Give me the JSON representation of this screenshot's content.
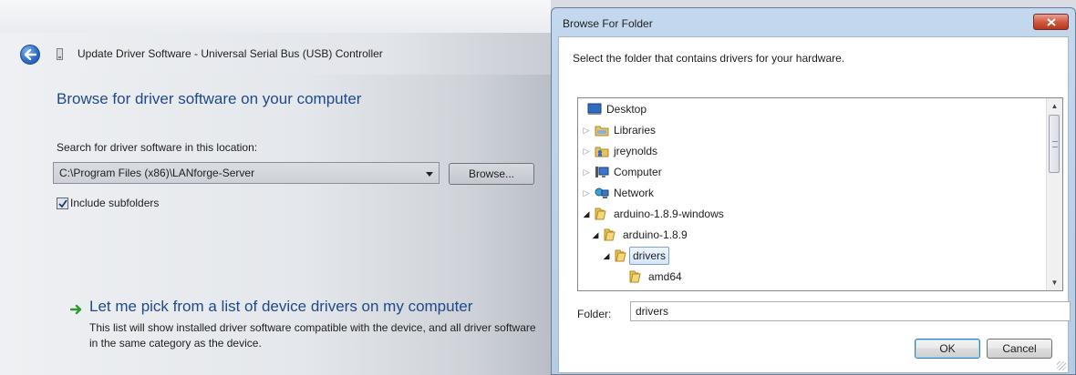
{
  "wizard": {
    "title": "Update Driver Software - Universal Serial Bus (USB) Controller",
    "heading": "Browse for driver software on your computer",
    "search_label": "Search for driver software in this location:",
    "path_value": "C:\\Program Files (x86)\\LANforge-Server",
    "browse_label": "Browse...",
    "include_subfolders_label": "Include subfolders",
    "include_subfolders_checked": true,
    "pick_title": "Let me pick from a list of device drivers on my computer",
    "pick_description": "This list will show installed driver software compatible with the device, and all driver software in the same category as the device."
  },
  "dialog": {
    "title": "Browse For Folder",
    "instruction": "Select the folder that contains drivers for your hardware.",
    "tree": [
      {
        "label": "Desktop",
        "icon": "desktop-icon",
        "expander": "none",
        "level": 0
      },
      {
        "label": "Libraries",
        "icon": "libraries-icon",
        "expander": "collapsed",
        "level": 0
      },
      {
        "label": "jreynolds",
        "icon": "user-folder-icon",
        "expander": "collapsed",
        "level": 0
      },
      {
        "label": "Computer",
        "icon": "computer-icon",
        "expander": "collapsed",
        "level": 0
      },
      {
        "label": "Network",
        "icon": "network-icon",
        "expander": "collapsed",
        "level": 0
      },
      {
        "label": "arduino-1.8.9-windows",
        "icon": "folder-icon",
        "expander": "expanded",
        "level": 0
      },
      {
        "label": "arduino-1.8.9",
        "icon": "folder-icon",
        "expander": "expanded",
        "level": 1
      },
      {
        "label": "drivers",
        "icon": "folder-icon",
        "expander": "expanded",
        "level": 2,
        "selected": true
      },
      {
        "label": "amd64",
        "icon": "folder-icon",
        "expander": "none",
        "level": 3
      }
    ],
    "folder_label": "Folder:",
    "folder_value": "drivers",
    "ok_label": "OK",
    "cancel_label": "Cancel"
  },
  "colors": {
    "heading_blue": "#1e4a8a",
    "dialog_frame": "#b5cce6",
    "close_red": "#cf5a40",
    "selection": "#d4e6fb"
  }
}
